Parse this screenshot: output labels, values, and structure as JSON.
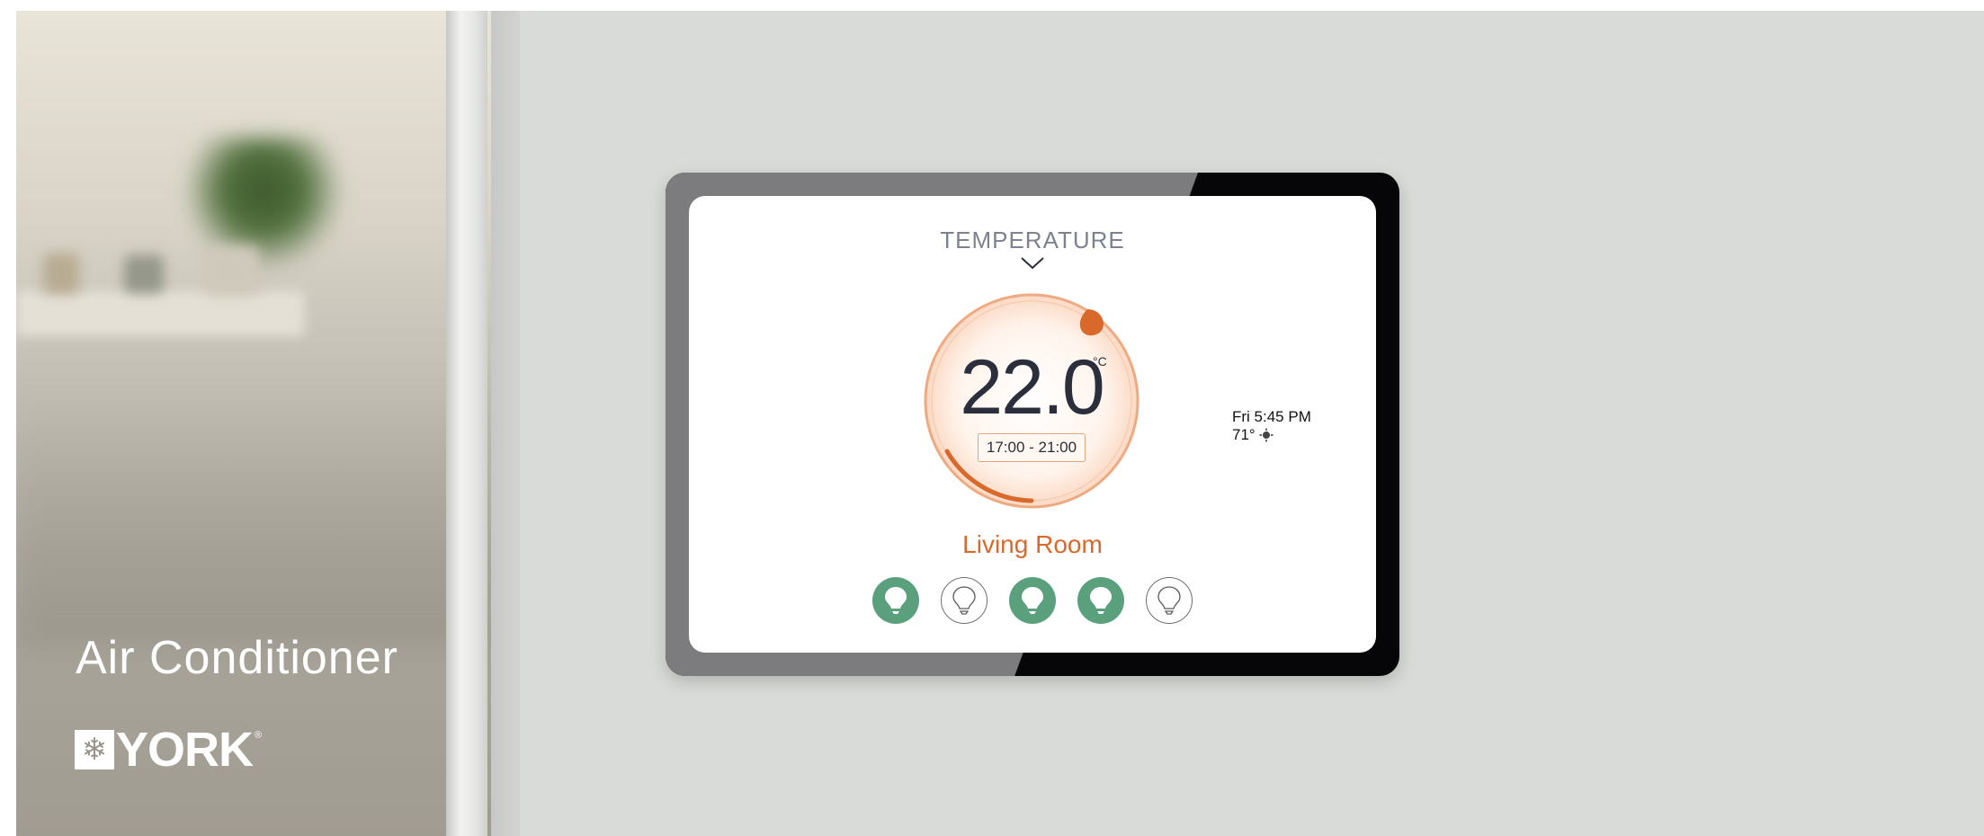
{
  "product": {
    "title": "Air Conditioner",
    "brand": "YORK",
    "brand_mark": "®",
    "logo_icon": "snowflake-icon"
  },
  "thermostat": {
    "mode_title": "TEMPERATURE",
    "temperature": "22.0",
    "unit": "°C",
    "schedule": "17:00 - 21:00",
    "room": "Living Room",
    "day_time": "Fri 5:45 PM",
    "weather_temp": "71°",
    "weather_icon": "sun-cloud-icon",
    "bulbs": [
      {
        "state": "on"
      },
      {
        "state": "off"
      },
      {
        "state": "on"
      },
      {
        "state": "on"
      },
      {
        "state": "off"
      }
    ]
  },
  "colors": {
    "accent": "#d9692a",
    "bulb_on": "#5aa07c",
    "text_dark": "#2b2f3b",
    "wall": "#d9dbd8"
  }
}
